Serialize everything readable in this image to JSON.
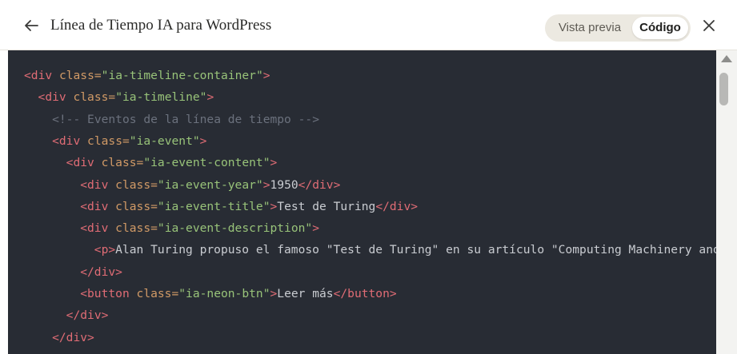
{
  "header": {
    "title": "Línea de Tiempo IA para WordPress",
    "toggle": {
      "preview_label": "Vista previa",
      "code_label": "Código",
      "selected": "Código"
    }
  },
  "icons": {
    "back": "arrow-left-icon",
    "close": "close-icon"
  },
  "code_lines": [
    {
      "indent": 0,
      "tokens": [
        {
          "t": "tag",
          "v": "<div"
        },
        {
          "t": "attr",
          "v": " class="
        },
        {
          "t": "str",
          "v": "\"ia-timeline-container\""
        },
        {
          "t": "tag",
          "v": ">"
        }
      ]
    },
    {
      "indent": 2,
      "tokens": [
        {
          "t": "tag",
          "v": "<div"
        },
        {
          "t": "attr",
          "v": " class="
        },
        {
          "t": "str",
          "v": "\"ia-timeline\""
        },
        {
          "t": "tag",
          "v": ">"
        }
      ]
    },
    {
      "indent": 4,
      "tokens": [
        {
          "t": "cmt",
          "v": "<!-- Eventos de la línea de tiempo -->"
        }
      ]
    },
    {
      "indent": 4,
      "tokens": [
        {
          "t": "tag",
          "v": "<div"
        },
        {
          "t": "attr",
          "v": " class="
        },
        {
          "t": "str",
          "v": "\"ia-event\""
        },
        {
          "t": "tag",
          "v": ">"
        }
      ]
    },
    {
      "indent": 6,
      "tokens": [
        {
          "t": "tag",
          "v": "<div"
        },
        {
          "t": "attr",
          "v": " class="
        },
        {
          "t": "str",
          "v": "\"ia-event-content\""
        },
        {
          "t": "tag",
          "v": ">"
        }
      ]
    },
    {
      "indent": 8,
      "tokens": [
        {
          "t": "tag",
          "v": "<div"
        },
        {
          "t": "attr",
          "v": " class="
        },
        {
          "t": "str",
          "v": "\"ia-event-year\""
        },
        {
          "t": "tag",
          "v": ">"
        },
        {
          "t": "txt",
          "v": "1950"
        },
        {
          "t": "tag",
          "v": "</div>"
        }
      ]
    },
    {
      "indent": 8,
      "tokens": [
        {
          "t": "tag",
          "v": "<div"
        },
        {
          "t": "attr",
          "v": " class="
        },
        {
          "t": "str",
          "v": "\"ia-event-title\""
        },
        {
          "t": "tag",
          "v": ">"
        },
        {
          "t": "txt",
          "v": "Test de Turing"
        },
        {
          "t": "tag",
          "v": "</div>"
        }
      ]
    },
    {
      "indent": 8,
      "tokens": [
        {
          "t": "tag",
          "v": "<div"
        },
        {
          "t": "attr",
          "v": " class="
        },
        {
          "t": "str",
          "v": "\"ia-event-description\""
        },
        {
          "t": "tag",
          "v": ">"
        }
      ]
    },
    {
      "indent": 10,
      "tokens": [
        {
          "t": "tag",
          "v": "<p>"
        },
        {
          "t": "txt",
          "v": "Alan Turing propuso el famoso \"Test de Turing\" en su artículo \"Computing Machinery and"
        }
      ]
    },
    {
      "indent": 8,
      "tokens": [
        {
          "t": "tag",
          "v": "</div>"
        }
      ]
    },
    {
      "indent": 8,
      "tokens": [
        {
          "t": "tag",
          "v": "<button"
        },
        {
          "t": "attr",
          "v": " class="
        },
        {
          "t": "str",
          "v": "\"ia-neon-btn\""
        },
        {
          "t": "tag",
          "v": ">"
        },
        {
          "t": "txt",
          "v": "Leer más"
        },
        {
          "t": "tag",
          "v": "</button>"
        }
      ]
    },
    {
      "indent": 6,
      "tokens": [
        {
          "t": "tag",
          "v": "</div>"
        }
      ]
    },
    {
      "indent": 4,
      "tokens": [
        {
          "t": "tag",
          "v": "</div>"
        }
      ]
    }
  ]
}
